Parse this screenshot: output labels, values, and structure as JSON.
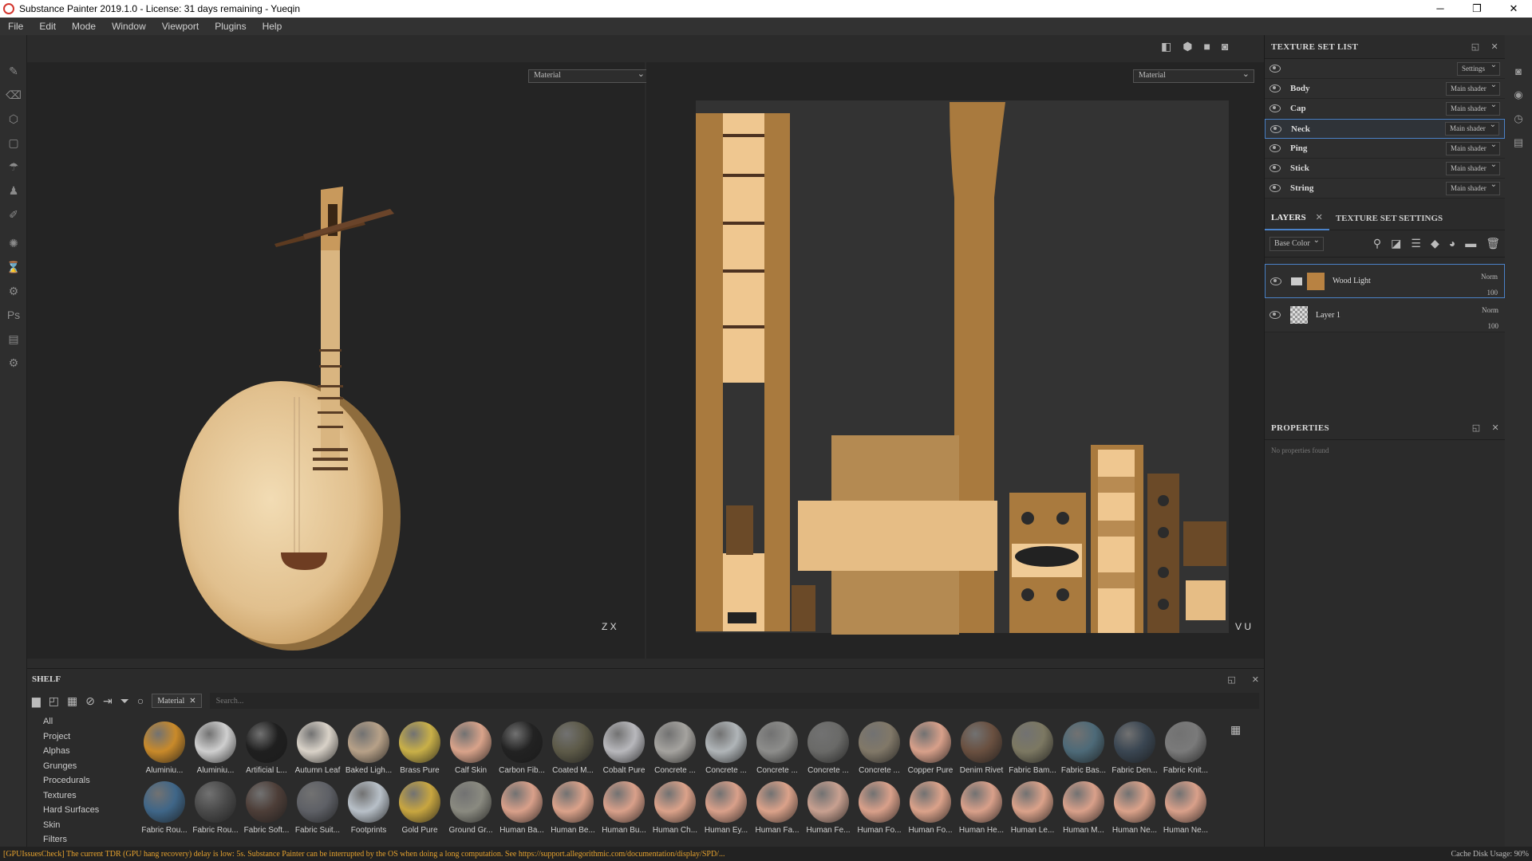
{
  "window": {
    "title": "Substance Painter 2019.1.0 - License: 31 days remaining - Yueqin",
    "minimize": "─",
    "maximize": "❐",
    "close": "✕"
  },
  "menu": [
    "File",
    "Edit",
    "Mode",
    "Window",
    "Viewport",
    "Plugins",
    "Help"
  ],
  "viewport3d": {
    "material_select": "Material",
    "axis": "Z X"
  },
  "viewport2d": {
    "material_select": "Material",
    "axis": "V U"
  },
  "texture_set_list": {
    "title": "TEXTURE SET LIST",
    "settings": "Settings",
    "items": [
      {
        "name": "Body",
        "shader": "Main shader"
      },
      {
        "name": "Cap",
        "shader": "Main shader"
      },
      {
        "name": "Neck",
        "shader": "Main shader"
      },
      {
        "name": "Ping",
        "shader": "Main shader"
      },
      {
        "name": "Stick",
        "shader": "Main shader"
      },
      {
        "name": "String",
        "shader": "Main shader"
      }
    ]
  },
  "layers": {
    "tab_layers": "LAYERS",
    "tab_settings": "TEXTURE SET SETTINGS",
    "channel": "Base Color",
    "items": [
      {
        "name": "Wood Light",
        "blend": "Norm",
        "opacity": "100"
      },
      {
        "name": "Layer 1",
        "blend": "Norm",
        "opacity": "100"
      }
    ]
  },
  "properties": {
    "title": "PROPERTIES",
    "empty": "No properties found"
  },
  "shelf": {
    "title": "SHELF",
    "filter": "Material",
    "search_placeholder": "Search...",
    "categories": [
      "All",
      "Project",
      "Alphas",
      "Grunges",
      "Procedurals",
      "Textures",
      "Hard Surfaces",
      "Skin",
      "Filters"
    ],
    "materials": [
      {
        "label": "Aluminiu...",
        "color": "#c98a2a"
      },
      {
        "label": "Aluminiu...",
        "color": "#cfcfcf"
      },
      {
        "label": "Artificial L...",
        "color": "#1f1f1f"
      },
      {
        "label": "Autumn Leaf",
        "color": "#d9d2c8"
      },
      {
        "label": "Baked Ligh...",
        "color": "#b7a188"
      },
      {
        "label": "Brass Pure",
        "color": "#c9b048"
      },
      {
        "label": "Calf Skin",
        "color": "#d9a38a"
      },
      {
        "label": "Carbon Fib...",
        "color": "#222222"
      },
      {
        "label": "Coated M...",
        "color": "#5d5a48"
      },
      {
        "label": "Cobalt Pure",
        "color": "#b8b8bc"
      },
      {
        "label": "Concrete ...",
        "color": "#a5a39f"
      },
      {
        "label": "Concrete ...",
        "color": "#b0b5b8"
      },
      {
        "label": "Concrete ...",
        "color": "#8d8d8b"
      },
      {
        "label": "Concrete ...",
        "color": "#6a6a68"
      },
      {
        "label": "Concrete ...",
        "color": "#817868"
      },
      {
        "label": "Copper Pure",
        "color": "#d8a08a"
      },
      {
        "label": "Denim Rivet",
        "color": "#6a5040"
      },
      {
        "label": "Fabric Bam...",
        "color": "#7c7862"
      },
      {
        "label": "Fabric Bas...",
        "color": "#4d6a78"
      },
      {
        "label": "Fabric Den...",
        "color": "#3a4652"
      },
      {
        "label": "Fabric Knit...",
        "color": "#7a7a7a"
      },
      {
        "label": "Fabric Rou...",
        "color": "#3f6688"
      },
      {
        "label": "Fabric Rou...",
        "color": "#4a4a4a"
      },
      {
        "label": "Fabric Soft...",
        "color": "#4d3e38"
      },
      {
        "label": "Fabric Suit...",
        "color": "#5e6066"
      },
      {
        "label": "Footprints",
        "color": "#b8c0c8"
      },
      {
        "label": "Gold Pure",
        "color": "#c8a640"
      },
      {
        "label": "Ground Gr...",
        "color": "#8a8a80"
      },
      {
        "label": "Human Ba...",
        "color": "#d9a08a"
      },
      {
        "label": "Human Be...",
        "color": "#dba28a"
      },
      {
        "label": "Human Bu...",
        "color": "#d9a08a"
      },
      {
        "label": "Human Ch...",
        "color": "#dba28a"
      },
      {
        "label": "Human Ey...",
        "color": "#d9a08a"
      },
      {
        "label": "Human Fa...",
        "color": "#dba28a"
      },
      {
        "label": "Human Fe...",
        "color": "#c8a090"
      },
      {
        "label": "Human Fo...",
        "color": "#d9a08a"
      },
      {
        "label": "Human Fo...",
        "color": "#dba28a"
      },
      {
        "label": "Human He...",
        "color": "#d9a08a"
      },
      {
        "label": "Human Le...",
        "color": "#dba28a"
      },
      {
        "label": "Human M...",
        "color": "#d9a08a"
      },
      {
        "label": "Human Ne...",
        "color": "#dba28a"
      },
      {
        "label": "Human Ne...",
        "color": "#d9a08a"
      }
    ]
  },
  "status": {
    "warning": "[GPUIssuesCheck] The current TDR (GPU hang recovery) delay is low: 5s. Substance Painter can be interrupted by the OS when doing a long computation. See https://support.allegorithmic.com/documentation/display/SPD/...",
    "cache": "Cache Disk Usage:    90%"
  }
}
